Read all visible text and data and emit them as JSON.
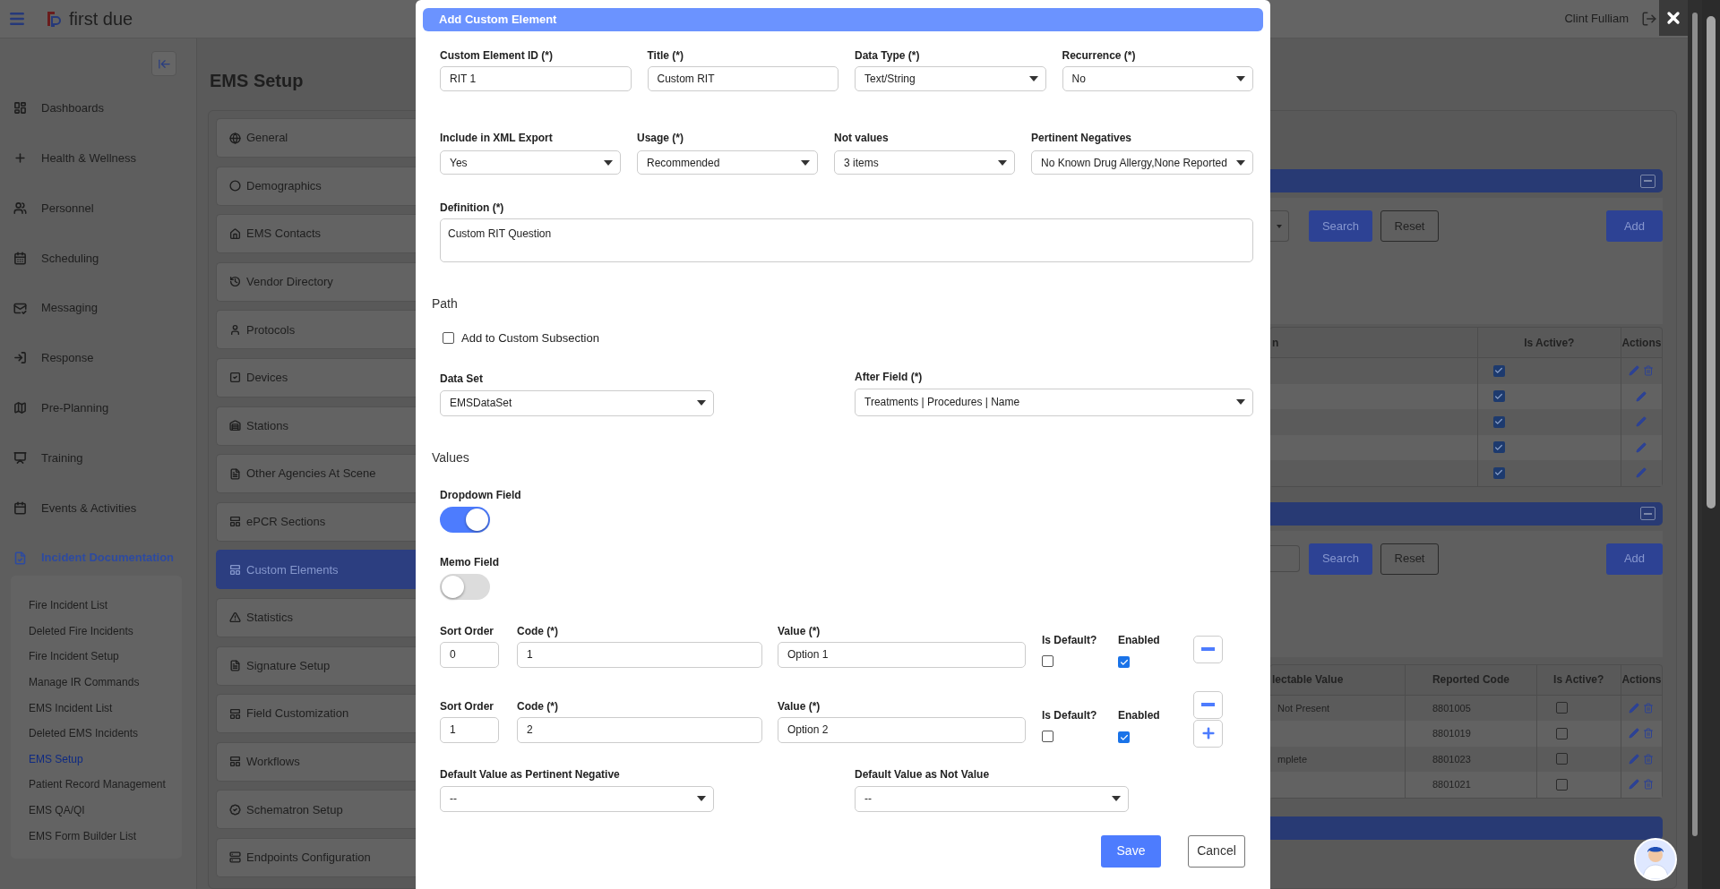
{
  "app_header": {
    "logo": "first due",
    "user": "Clint Fulliam"
  },
  "sidebar": {
    "items": [
      {
        "label": "Dashboards",
        "selected": false
      },
      {
        "label": "Health & Wellness",
        "selected": false
      },
      {
        "label": "Personnel",
        "selected": false
      },
      {
        "label": "Scheduling",
        "selected": false
      },
      {
        "label": "Messaging",
        "selected": false
      },
      {
        "label": "Response",
        "selected": false
      },
      {
        "label": "Pre-Planning",
        "selected": false
      },
      {
        "label": "Training",
        "selected": false
      },
      {
        "label": "Events & Activities",
        "selected": false
      },
      {
        "label": "Incident Documentation",
        "selected": true
      }
    ],
    "submenu": [
      {
        "label": "Fire Incident List",
        "selected": false
      },
      {
        "label": "Deleted Fire Incidents",
        "selected": false
      },
      {
        "label": "Fire Incident Setup",
        "selected": false
      },
      {
        "label": "Manage IR Commands",
        "selected": false
      },
      {
        "label": "EMS Incident List",
        "selected": false
      },
      {
        "label": "Deleted EMS Incidents",
        "selected": false
      },
      {
        "label": "EMS Setup",
        "selected": true
      },
      {
        "label": "Patient Record Management",
        "selected": false
      },
      {
        "label": "EMS QA/QI",
        "selected": false
      },
      {
        "label": "EMS Form Builder List",
        "selected": false
      }
    ]
  },
  "page": {
    "title": "EMS Setup"
  },
  "setup_menu": [
    {
      "label": "General",
      "selected": false
    },
    {
      "label": "Demographics",
      "selected": false
    },
    {
      "label": "EMS Contacts",
      "selected": false
    },
    {
      "label": "Vendor Directory",
      "selected": false
    },
    {
      "label": "Protocols",
      "selected": false
    },
    {
      "label": "Devices",
      "selected": false
    },
    {
      "label": "Stations",
      "selected": false
    },
    {
      "label": "Other Agencies At Scene",
      "selected": false
    },
    {
      "label": "ePCR Sections",
      "selected": false
    },
    {
      "label": "Custom Elements",
      "selected": true
    },
    {
      "label": "Statistics",
      "selected": false
    },
    {
      "label": "Signature Setup",
      "selected": false
    },
    {
      "label": "Field Customization",
      "selected": false
    },
    {
      "label": "Workflows",
      "selected": false
    },
    {
      "label": "Schematron Setup",
      "selected": false
    },
    {
      "label": "Endpoints Configuration",
      "selected": false
    }
  ],
  "sections": [
    {
      "kind": "select",
      "buttons": [
        "Search",
        "Reset",
        "Add"
      ],
      "table": {
        "columns": [
          "n",
          "Is Active?",
          "Actions"
        ],
        "rows": [
          {
            "active": true,
            "deletable": true
          },
          {
            "active": true,
            "deletable": false
          },
          {
            "active": true,
            "deletable": false
          },
          {
            "active": true,
            "deletable": false
          },
          {
            "active": true,
            "deletable": false
          }
        ]
      }
    },
    {
      "kind": "input",
      "buttons": [
        "Search",
        "Reset",
        "Add"
      ],
      "table": {
        "columns": [
          "lectable Value",
          "Reported Code",
          "Is Active?",
          "Actions"
        ],
        "rows": [
          {
            "value": "Not Present",
            "code": "8801005",
            "active": false,
            "deletable": true
          },
          {
            "code": "8801019",
            "active": false,
            "deletable": true
          },
          {
            "value": "mplete",
            "code": "8801023",
            "active": false,
            "deletable": true
          },
          {
            "code": "8801021",
            "active": false,
            "deletable": true
          }
        ]
      }
    }
  ],
  "dialog": {
    "title": "Add Custom Element",
    "row_1": [
      {
        "label": "Custom Element ID (*)",
        "kind": "text",
        "value": "RIT 1"
      },
      {
        "label": "Title (*)",
        "kind": "text",
        "value": "Custom RIT"
      },
      {
        "label": "Data Type (*)",
        "kind": "select",
        "value": "Text/String"
      },
      {
        "label": "Recurrence (*)",
        "kind": "select",
        "value": "No"
      }
    ],
    "row_2": [
      {
        "label": "Include in XML Export",
        "kind": "select",
        "value": "Yes"
      },
      {
        "label": "Usage (*)",
        "kind": "select",
        "value": "Recommended"
      },
      {
        "label": "Not values",
        "kind": "select",
        "value": "3 items"
      },
      {
        "label": "Pertinent Negatives",
        "kind": "select",
        "value": "No Known Drug Allergy,None Reported"
      }
    ],
    "definition": {
      "label": "Definition (*)",
      "value": "Custom RIT Question"
    },
    "path": {
      "heading": "Path",
      "subsection": {
        "label": "Add to Custom Subsection",
        "checked": false
      },
      "data_set": {
        "label": "Data Set",
        "value": "EMSDataSet"
      },
      "after_field": {
        "label": "After Field (*)",
        "value": "Treatments | Procedures | Name"
      }
    },
    "values": {
      "heading": "Values",
      "toggles": [
        {
          "label": "Dropdown Field",
          "on": true
        },
        {
          "label": "Memo Field",
          "on": false
        }
      ],
      "rows": [
        {
          "labels": {
            "sort_order": "Sort Order",
            "code": "Code (*)",
            "value": "Value (*)",
            "is_default": "Is Default?",
            "enabled": "Enabled"
          },
          "sort_order": "0",
          "code": "1",
          "value": "Option 1",
          "is_default": false,
          "enabled": true,
          "can_add": false
        },
        {
          "labels": {
            "sort_order": "Sort Order",
            "code": "Code (*)",
            "value": "Value (*)",
            "is_default": "Is Default?",
            "enabled": "Enabled"
          },
          "sort_order": "1",
          "code": "2",
          "value": "Option 2",
          "is_default": false,
          "enabled": true,
          "can_add": true
        }
      ]
    },
    "defaults": [
      {
        "label": "Default Value as Pertinent Negative",
        "value": "--"
      },
      {
        "label": "Default Value as Not Value",
        "value": "--"
      }
    ],
    "buttons": [
      {
        "label": "Save",
        "kind": "primary"
      },
      {
        "label": "Cancel",
        "kind": "secondary"
      }
    ]
  }
}
